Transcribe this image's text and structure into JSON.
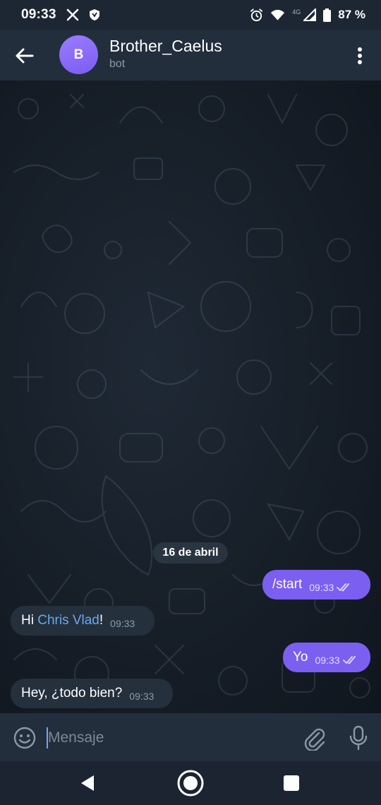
{
  "status_bar": {
    "time": "09:33",
    "network": "4G",
    "battery": "87 %"
  },
  "header": {
    "avatar_letter": "B",
    "title": "Brother_Caelus",
    "subtitle": "bot"
  },
  "chat": {
    "date_separator": "16 de abril",
    "messages": [
      {
        "direction": "out",
        "text": "/start",
        "time": "09:33"
      },
      {
        "direction": "in",
        "text_before": "Hi ",
        "mention": "Chris Vlad",
        "text_after": "!",
        "time": "09:33"
      },
      {
        "direction": "out",
        "text": "Yo",
        "time": "09:33"
      },
      {
        "direction": "in",
        "text": "Hey, ¿todo bien?",
        "time": "09:33"
      }
    ]
  },
  "input": {
    "placeholder": "Mensaje",
    "value": ""
  },
  "colors": {
    "accent": "#7b5ff0",
    "header_bg": "#232e3c",
    "incoming_bubble": "#25303d",
    "link": "#67a9ee"
  },
  "icons": {
    "status_left": [
      "x-logo-icon",
      "shield-icon"
    ],
    "status_right": [
      "alarm-icon",
      "wifi-icon",
      "signal-icon",
      "battery-icon"
    ],
    "header": [
      "back-arrow-icon",
      "more-vert-icon"
    ],
    "input": [
      "emoji-icon",
      "attach-icon",
      "mic-icon"
    ],
    "nav": [
      "nav-back-icon",
      "nav-home-icon",
      "nav-recents-icon"
    ]
  }
}
